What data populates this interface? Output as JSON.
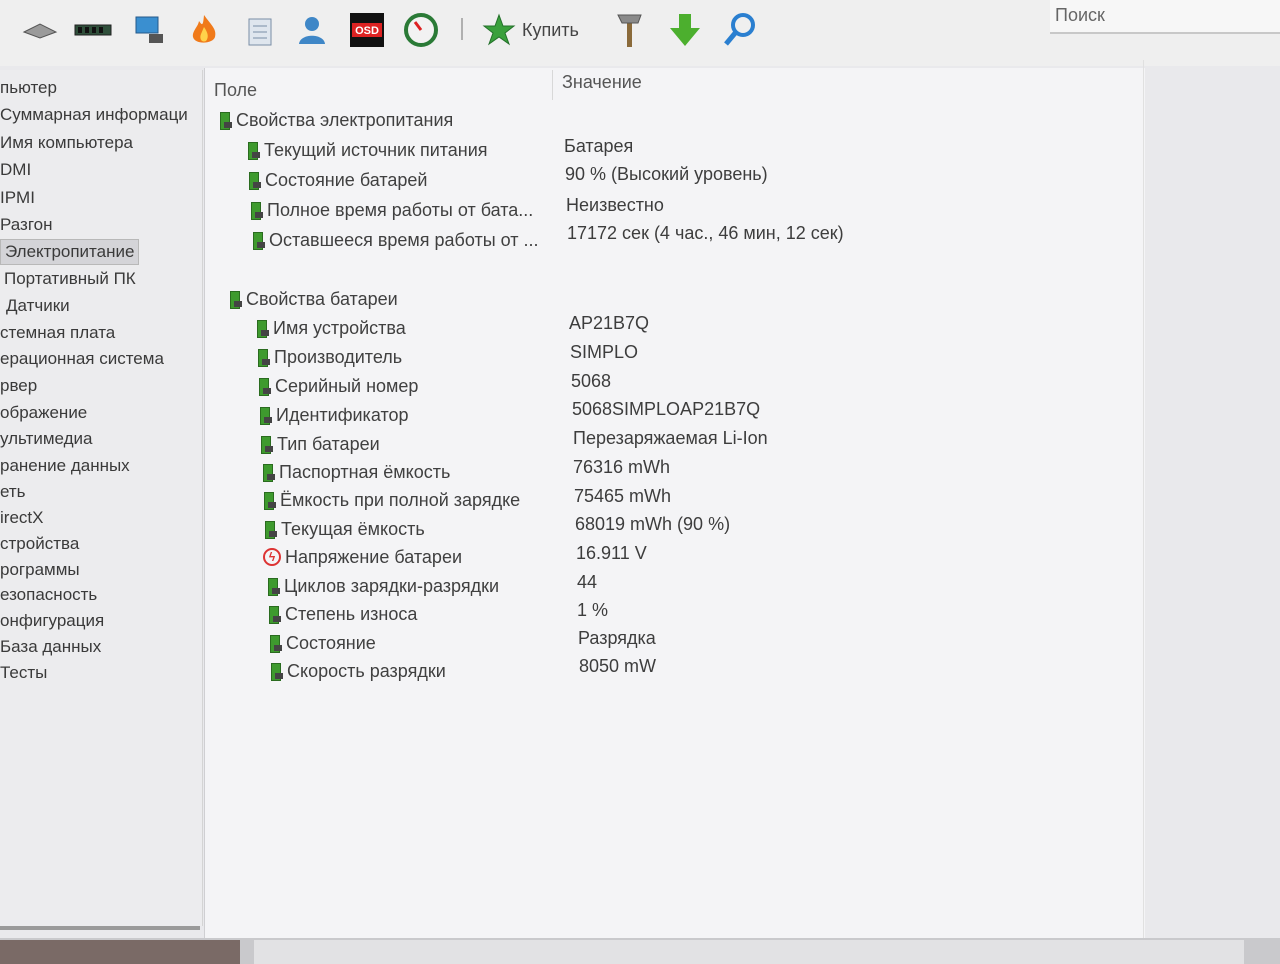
{
  "toolbar": {
    "icons": [
      "drive-icon",
      "memory-icon",
      "network-icon",
      "flame-icon",
      "report-icon",
      "user-icon",
      "osd-icon",
      "gauge-icon",
      "buy-star-icon",
      "tools-icon",
      "download-icon",
      "search-magnifier-icon"
    ],
    "osd_label": "OSD",
    "buy_label": "Купить"
  },
  "search": {
    "placeholder": "Поиск"
  },
  "sidebar": {
    "items": [
      {
        "label": "пьютер"
      },
      {
        "label": "Суммарная информаци"
      },
      {
        "label": "Имя компьютера"
      },
      {
        "label": "DMI"
      },
      {
        "label": "IPMI"
      },
      {
        "label": "Разгон"
      },
      {
        "label": "Электропитание"
      },
      {
        "label": "Портативный ПК"
      },
      {
        "label": "Датчики"
      },
      {
        "label": "стемная плата"
      },
      {
        "label": "ерационная система"
      },
      {
        "label": "рвер"
      },
      {
        "label": "ображение"
      },
      {
        "label": "ультимедиа"
      },
      {
        "label": "ранение данных"
      },
      {
        "label": "еть"
      },
      {
        "label": "irectX"
      },
      {
        "label": "стройства"
      },
      {
        "label": "рограммы"
      },
      {
        "label": "езопасность"
      },
      {
        "label": "онфигурация"
      },
      {
        "label": "База данных"
      },
      {
        "label": "Тесты"
      }
    ],
    "selected": "Электропитание"
  },
  "table": {
    "col_field": "Поле",
    "col_value": "Значение",
    "group1": {
      "title": "Свойства электропитания",
      "rows": [
        {
          "field": "Текущий источник питания",
          "value": "Батарея"
        },
        {
          "field": "Состояние батарей",
          "value": "90 % (Высокий уровень)"
        },
        {
          "field": "Полное время работы от бата...",
          "value": "Неизвестно"
        },
        {
          "field": "Оставшееся время работы от ...",
          "value": "17172 сек (4 час., 46 мин, 12 сек)"
        }
      ]
    },
    "group2": {
      "title": "Свойства батареи",
      "rows": [
        {
          "field": "Имя устройства",
          "value": "AP21B7Q"
        },
        {
          "field": "Производитель",
          "value": "SIMPLO"
        },
        {
          "field": "Серийный номер",
          "value": "5068"
        },
        {
          "field": "Идентификатор",
          "value": "5068SIMPLOAP21B7Q"
        },
        {
          "field": "Тип батареи",
          "value": "Перезаряжаемая Li-Ion"
        },
        {
          "field": "Паспортная ёмкость",
          "value": "76316 mWh"
        },
        {
          "field": "Ёмкость при полной зарядке",
          "value": "75465 mWh"
        },
        {
          "field": "Текущая ёмкость",
          "value": "68019 mWh  (90 %)"
        },
        {
          "field": "Напряжение батареи",
          "value": "16.911 V"
        },
        {
          "field": "Циклов зарядки-разрядки",
          "value": "44"
        },
        {
          "field": "Степень износа",
          "value": "1 %"
        },
        {
          "field": "Состояние",
          "value": "Разрядка"
        },
        {
          "field": "Скорость разрядки",
          "value": "8050 mW"
        }
      ]
    }
  }
}
